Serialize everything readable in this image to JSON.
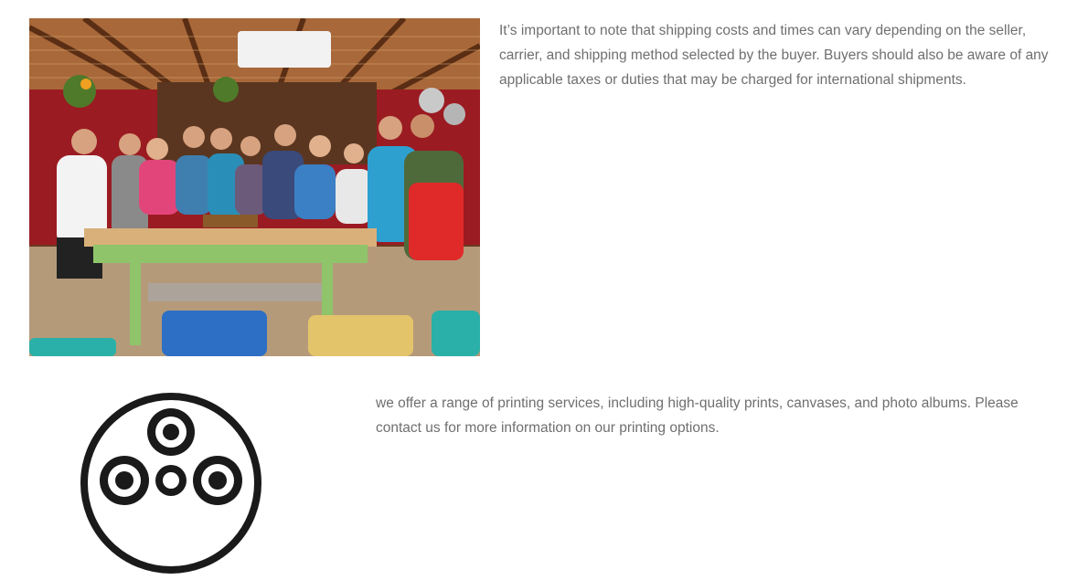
{
  "shipping_section": {
    "text": "It’s important to note that shipping costs and times can vary depending on the seller, carrier, and shipping method selected by the buyer. Buyers should also be aware of any applicable taxes or duties that may be charged for international shipments.",
    "image_icon": "group-photo-cooking-class"
  },
  "printing_section": {
    "text": "we offer a range of printing services, including high-quality prints, canvases, and photo albums. Please contact us for more information on our printing options.",
    "icon": "film-reel-icon"
  },
  "colors": {
    "body_text": "#6f6f6f",
    "icon": "#1a1a1a",
    "background": "#ffffff"
  }
}
